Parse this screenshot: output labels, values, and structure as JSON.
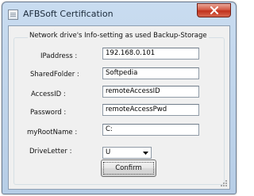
{
  "window": {
    "title": "AFBSoft Certification"
  },
  "group": {
    "legend": "Network drive's Info-setting as used Backup-Storage"
  },
  "fields": [
    {
      "label": "IPaddress :",
      "value": "192.168.0.101"
    },
    {
      "label": "SharedFolder :",
      "value": "Softpedia"
    },
    {
      "label": "AccessID :",
      "value": "remoteAccessID"
    },
    {
      "label": "Password :",
      "value": "remoteAccessPwd"
    },
    {
      "label": "myRootName :",
      "value": "C:"
    }
  ],
  "drive": {
    "label": "DriveLetter :",
    "value": "U"
  },
  "confirm_label": "Confirm",
  "colors": {
    "close_button": "#c94a33",
    "client_bg": "#f0f0f0",
    "frame": "#b9d1ea"
  },
  "icons": {
    "app": "window-icon",
    "close": "close-icon",
    "dropdown": "chevron-down-icon"
  }
}
